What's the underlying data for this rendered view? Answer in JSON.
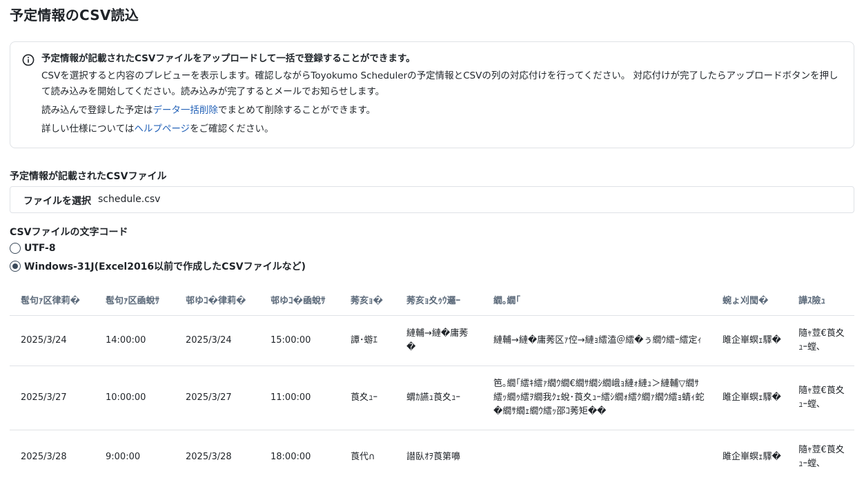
{
  "page": {
    "title": "予定情報のCSV読込"
  },
  "info": {
    "lead": "予定情報が記載されたCSVファイルをアップロードして一括で登録することができます。",
    "paragraph": "CSVを選択すると内容のプレビューを表示します。確認しながらToyokumo Schedulerの予定情報とCSVの列の対応付けを行ってください。 対応付けが完了したらアップロードボタンを押して読み込みを開始してください。読み込みが完了するとメールでお知らせします。",
    "delete_prefix": "読み込んで登録した予定は",
    "delete_link": "データ一括削除",
    "delete_suffix": "でまとめて削除することができます。",
    "help_prefix": "詳しい仕様については",
    "help_link": "ヘルプページ",
    "help_suffix": "をご確認ください。",
    "icon": "info-icon"
  },
  "file_field": {
    "label": "予定情報が記載されたCSVファイル",
    "button_label": "ファイルを選択",
    "file_name": "schedule.csv"
  },
  "encoding": {
    "label": "CSVファイルの文字コード",
    "options": [
      "UTF-8",
      "Windows-31J(Excel2016以前で作成したCSVファイルなど)"
    ],
    "selected": "Windows-31J(Excel2016以前で作成したCSVファイルなど)"
  },
  "preview": {
    "headers": [
      "髢句ｧ区律莉�",
      "髢句ｧ区凾蛻ｻ",
      "邨ゆｺ�律莉�",
      "邨ゆｺ�凾蛻ｻ",
      "莠亥ｮ�",
      "莠亥ｮ夊ｩｳ邏ｰ",
      "繝｡繝｢",
      "蜿ょ刈閠�",
      "譁ｽ險ｭ"
    ],
    "rows": [
      [
        "2025/3/24",
        "14:00:00",
        "2025/3/24",
        "15:00:00",
        "譚･蝣ｴ",
        "縺輔→縺�庸莠�",
        "縺輔→縺�庸莠区ｧ倥→縺ｮ繧溘＠繧�ぅ繝ｳ繧ｰ繧定ｨ",
        "雎企崋螟ｪ驛�",
        "隨ｬ荳€莨夊ｭｰ螳､"
      ],
      [
        "2025/3/27",
        "10:00:00",
        "2025/3/27",
        "11:00:00",
        "莨夊ｭｰ",
        "蝟ｶ讌ｭ莨夊ｭｰ",
        "笆｡繝｢繧ｷ繧ｧ繝ｳ繝€繝ｻ繝ｼ繝峨ｮ縺ｫ縺ｭ＞縺輔▽繝ｻ繧ｯ繝ｩ繧ｦ繝我ｸｪ蛻･莨夊ｭｰ繧ｼ繝ｫ繧ｸ繝ｧ繝ｳ繧ｮ蜻ｨ蛇�繝ｻ繝ｪ繝ｳ繧ｯ邵ｺ莠矩��",
        "雎企崋螟ｪ驛�",
        "隨ｬ荳€莨夊ｭｰ螳､"
      ],
      [
        "2025/3/28",
        "9:00:00",
        "2025/3/28",
        "18:00:00",
        "莨代∩",
        "譛臥ｵｦ莨第嚊",
        "",
        "雎企崋螟ｪ驛�",
        "隨ｬ荳€莨夊ｭｰ螳､"
      ]
    ]
  },
  "colors": {
    "link": "#2563b8",
    "border": "#dfe2e6",
    "header_text": "#5d6b7b",
    "radio": "#3b4a5a"
  }
}
